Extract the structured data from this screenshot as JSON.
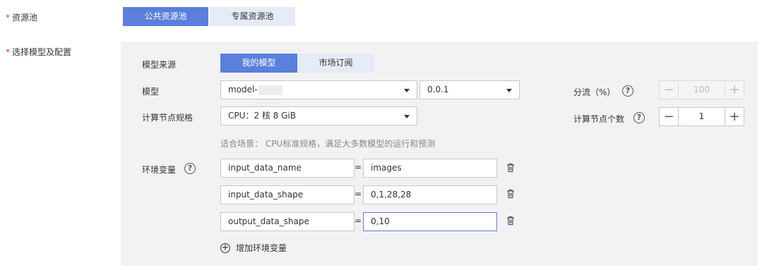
{
  "resource_pool": {
    "label": "资源池",
    "options": [
      "公共资源池",
      "专属资源池"
    ],
    "selected": "公共资源池"
  },
  "model_config": {
    "label": "选择模型及配置",
    "source": {
      "label": "模型来源",
      "options": [
        "我的模型",
        "市场订阅"
      ],
      "selected": "我的模型"
    },
    "model": {
      "label": "模型",
      "name_value": "model-",
      "version_value": "0.0.1"
    },
    "compute_spec": {
      "label": "计算节点规格",
      "value": "CPU：2 核 8 GiB",
      "hint": "适合场景： CPU标准规格，满足大多数模型的运行和预测"
    },
    "env": {
      "label": "环境变量",
      "rows": [
        {
          "key": "input_data_name",
          "eq": "=",
          "value": "images"
        },
        {
          "key": "input_data_shape",
          "eq": "=",
          "value": "0,1,28,28"
        },
        {
          "key": "output_data_shape",
          "eq": "=",
          "value": "0,10"
        }
      ],
      "add_label": "增加环境变量"
    },
    "traffic": {
      "label": "分流（%）",
      "value": "100",
      "minus": "−",
      "plus": "+"
    },
    "node_count": {
      "label": "计算节点个数",
      "value": "1",
      "minus": "−",
      "plus": "+"
    }
  },
  "help_glyph": "?",
  "colors": {
    "accent": "#5a7fdc",
    "accent_light": "#e6ebf8",
    "required": "#e4393c",
    "panel_bg": "#f2f2f2"
  }
}
